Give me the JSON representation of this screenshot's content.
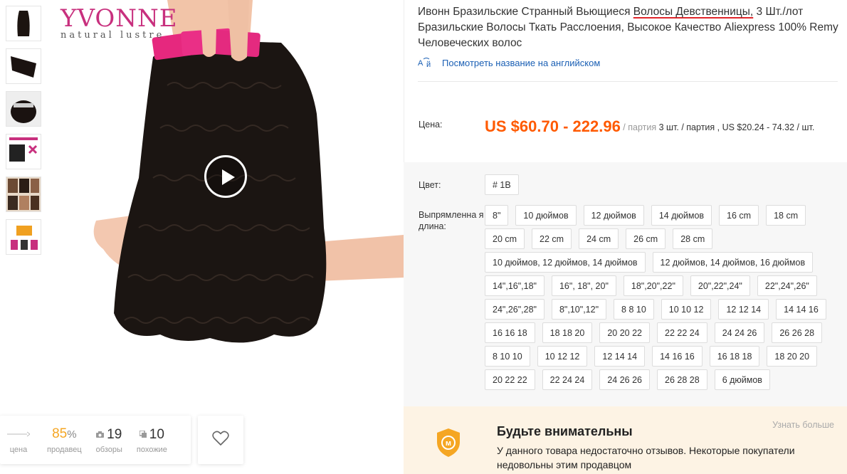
{
  "gallery": {
    "brand": "YVONNE",
    "brand_sub": "natural lustre",
    "thumbnails": [
      "thumb-1",
      "thumb-2",
      "thumb-3",
      "thumb-4",
      "thumb-5",
      "thumb-6"
    ]
  },
  "stats": {
    "price_label": "цена",
    "seller_value": "85",
    "seller_unit": "%",
    "seller_label": "продавец",
    "reviews_value": "19",
    "reviews_label": "обзоры",
    "similar_value": "10",
    "similar_label": "похожие"
  },
  "product": {
    "title_part1": "Ивонн Бразильские Странный Вьющиеся ",
    "title_underlined": "Волосы Девственницы,",
    "title_part2": " 3 Шт./лот Бразильские Волосы Ткать Расслоения, Высокое Качество Aliexpress 100% Remy Человеческих волос",
    "translate_link": "Посмотреть название на английском"
  },
  "price": {
    "label": "Цена:",
    "range": "US $60.70 - 222.96",
    "unit": "/ партия",
    "detail": "3 шт. / партия , US $20.24 - 74.32 / шт."
  },
  "options": {
    "color_label": "Цвет:",
    "colors": [
      "# 1B"
    ],
    "length_label": "Выпрямленна я длина:",
    "lengths": [
      "8\"",
      "10 дюймов",
      "12 дюймов",
      "14 дюймов",
      "16 cm",
      "18 cm",
      "20 cm",
      "22 cm",
      "24 cm",
      "26 cm",
      "28 cm",
      "10 дюймов, 12 дюймов, 14 дюймов",
      "12 дюймов, 14 дюймов, 16 дюймов",
      "14\",16\",18\"",
      "16\", 18\", 20\"",
      "18\",20\",22\"",
      "20\",22\",24\"",
      "22\",24\",26\"",
      "24\",26\",28\"",
      "8\",10\",12\"",
      "8 8 10",
      "10 10 12",
      "12 12 14",
      "14 14 16",
      "16 16 18",
      "18 18 20",
      "20 20 22",
      "22 22 24",
      "24 24 26",
      "26 26 28",
      "8 10 10",
      "10 12 12",
      "12 14 14",
      "14 16 16",
      "16 18 18",
      "18 20 20",
      "20 22 22",
      "22 24 24",
      "24 26 26",
      "26 28 28",
      "6 дюймов"
    ]
  },
  "warning": {
    "heading": "Будьте внимательны",
    "body": "У данного товара недостаточно отзывов. Некоторые покупатели недовольны этим продавцом",
    "more_link": "Узнать больше"
  },
  "colors": {
    "price": "#ff5a00",
    "link": "#1a5fb4",
    "accent_orange": "#f5a623",
    "warn_bg": "#fdf3e4"
  }
}
